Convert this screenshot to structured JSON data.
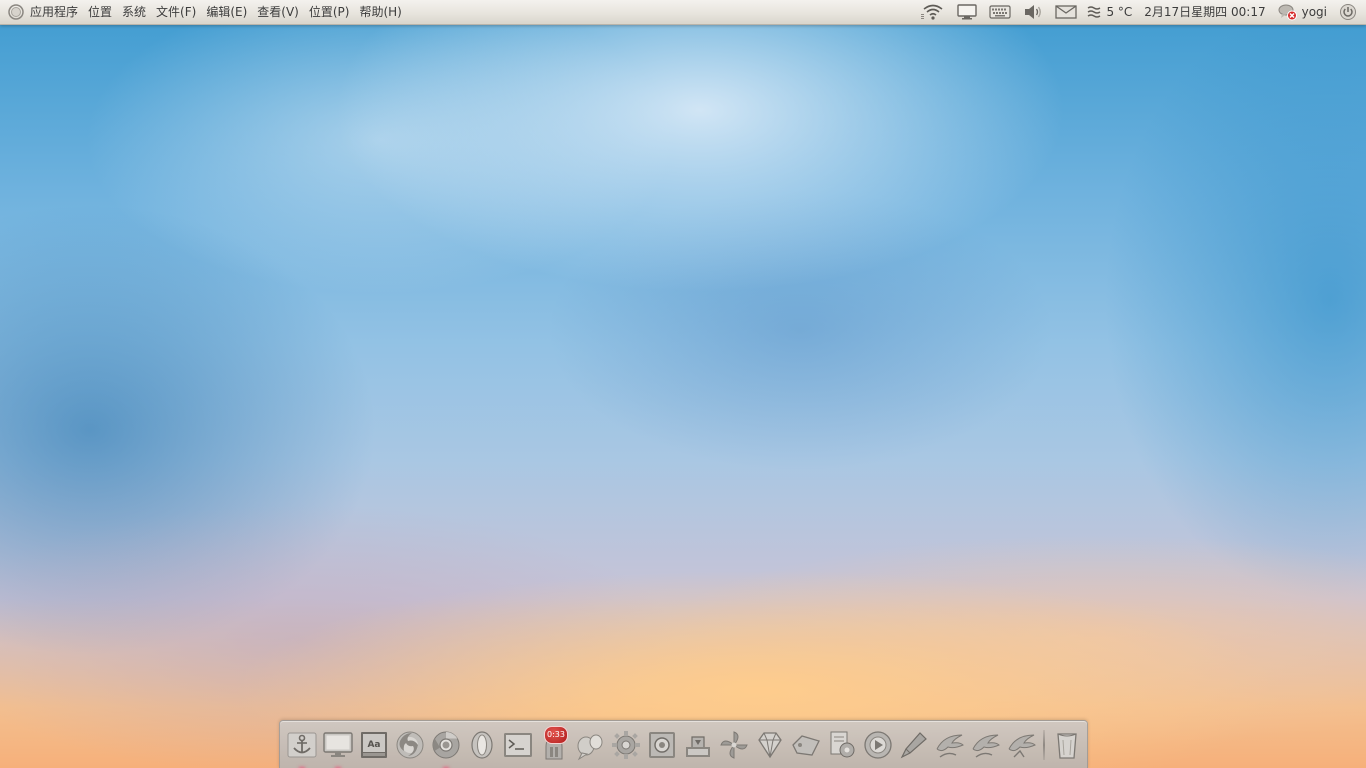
{
  "top_panel": {
    "menus": [
      "应用程序",
      "位置",
      "系统",
      "文件(F)",
      "编辑(E)",
      "查看(V)",
      "位置(P)",
      "帮助(H)"
    ],
    "weather": "5 °C",
    "clock": "2月17日星期四 00:17",
    "username": "yogi",
    "icons": [
      "ubuntu-logo-icon",
      "wifi-icon",
      "display-icon",
      "keyboard-icon",
      "volume-icon",
      "mail-icon",
      "weather-icon",
      "chat-offline-icon",
      "power-icon"
    ]
  },
  "dock": {
    "items": [
      {
        "name": "anchor-icon"
      },
      {
        "name": "monitor-icon"
      },
      {
        "name": "font-viewer-icon"
      },
      {
        "name": "firefox-icon"
      },
      {
        "name": "chrome-icon"
      },
      {
        "name": "opera-icon"
      },
      {
        "name": "terminal-icon"
      },
      {
        "name": "timer-icon",
        "badge": "0:33"
      },
      {
        "name": "pidgin-icon"
      },
      {
        "name": "settings-gear-icon"
      },
      {
        "name": "screenshot-icon"
      },
      {
        "name": "inkscape-icon"
      },
      {
        "name": "pinwheel-icon"
      },
      {
        "name": "gem-icon"
      },
      {
        "name": "tag-icon"
      },
      {
        "name": "document-icon"
      },
      {
        "name": "disk-icon"
      },
      {
        "name": "pen-icon"
      },
      {
        "name": "bird-icon"
      },
      {
        "name": "bird-icon"
      },
      {
        "name": "bird-icon"
      },
      {
        "name": "trash-icon"
      }
    ],
    "running_indicators": [
      1,
      2,
      5
    ]
  }
}
